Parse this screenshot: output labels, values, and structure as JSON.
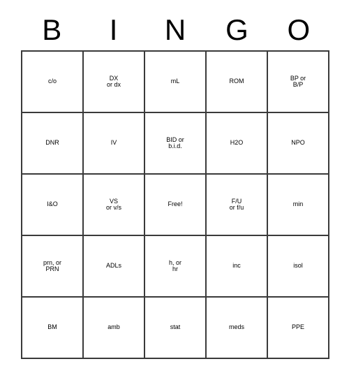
{
  "card": {
    "headers": [
      "B",
      "I",
      "N",
      "G",
      "O"
    ],
    "free_space": "Free!",
    "rows": [
      [
        {
          "lines": [
            "c/o"
          ],
          "size": "lg"
        },
        {
          "lines": [
            "DX",
            "or dx"
          ],
          "size": "lg"
        },
        {
          "lines": [
            "mL"
          ],
          "size": "lg"
        },
        {
          "lines": [
            "ROM"
          ],
          "size": "md"
        },
        {
          "lines": [
            "BP or",
            "B/P"
          ],
          "size": "md"
        }
      ],
      [
        {
          "lines": [
            "DNR"
          ],
          "size": "md"
        },
        {
          "lines": [
            "IV"
          ],
          "size": "lg"
        },
        {
          "lines": [
            "BID or",
            "b.i.d."
          ],
          "size": "xs"
        },
        {
          "lines": [
            "H2O"
          ],
          "size": "md"
        },
        {
          "lines": [
            "NPO"
          ],
          "size": "md"
        }
      ],
      [
        {
          "lines": [
            "I&O"
          ],
          "size": "md"
        },
        {
          "lines": [
            "VS",
            "or v/s"
          ],
          "size": "sm"
        },
        {
          "lines": [
            "Free!"
          ],
          "size": "md"
        },
        {
          "lines": [
            "F/U",
            "or f/u"
          ],
          "size": "sm"
        },
        {
          "lines": [
            "min"
          ],
          "size": "lg"
        }
      ],
      [
        {
          "lines": [
            "prn, or",
            "PRN"
          ],
          "size": "sm"
        },
        {
          "lines": [
            "ADLs"
          ],
          "size": "md"
        },
        {
          "lines": [
            "h, or",
            "hr"
          ],
          "size": "lg"
        },
        {
          "lines": [
            "inc"
          ],
          "size": "lg"
        },
        {
          "lines": [
            "isol"
          ],
          "size": "lg"
        }
      ],
      [
        {
          "lines": [
            "BM"
          ],
          "size": "lg"
        },
        {
          "lines": [
            "amb"
          ],
          "size": "lg"
        },
        {
          "lines": [
            "stat"
          ],
          "size": "lg"
        },
        {
          "lines": [
            "meds"
          ],
          "size": "md"
        },
        {
          "lines": [
            "PPE"
          ],
          "size": "md"
        }
      ]
    ]
  },
  "colors": {
    "border": "#3a3a3a",
    "text": "#000000",
    "background": "#ffffff"
  }
}
